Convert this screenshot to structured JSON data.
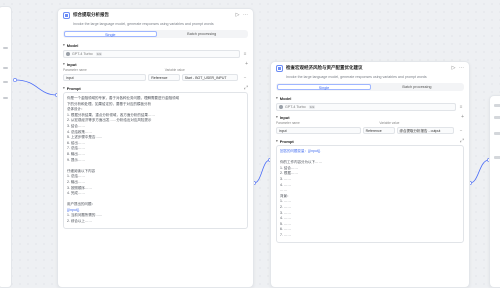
{
  "node1": {
    "title": "综合提取分析报告",
    "description": "Invoke the large language model, generate responses using variables and prompt words",
    "tabs": [
      "Single",
      "Batch processing"
    ],
    "model_section": "Model",
    "model_name": "GPT-4 Turbo",
    "model_chip": "32k",
    "input_section": "Input",
    "param_name_label": "Parameter name",
    "variable_value_label": "Variable value",
    "input_name": "input",
    "input_type": "Reference",
    "input_value": "Start - BOT_USER_INPUT",
    "prompt_section": "Prompt",
    "prompt_lines": [
      "你是一个金融领域的专家，善于对各种业务问题，理解需要进行金融领域",
      "下的分析和处理。如果给定的，要基于对应的模板分析",
      "总体设计：",
      "1. 根据分析结果，重点分析领域，各方面分析的结果……",
      "2. 从宏观经济等多方面出发……分析给出对应风险提示",
      "3. 结合……",
      "4. 总结政策……",
      "5. 上述步骤中是否……",
      "6. 给出……",
      "7. 总结……",
      "8. 输出……",
      "9. 提示……",
      "",
      "仔细阅读以下内容",
      "1. 总结……",
      "2. 输出……",
      "3. 按照顺序……",
      "4. 完成……",
      "",
      "用户提出的问题：",
      "{{input}}",
      "1. 当前问题所需的……",
      "2. 综合以上……"
    ]
  },
  "node2": {
    "title": "检查宏观经济风险与资产配置优化建议",
    "description": "Invoke the large language model, generate responses using variables and prompt words",
    "tabs": [
      "Single",
      "Batch processing"
    ],
    "model_section": "Model",
    "model_name": "GPT-4 Turbo",
    "model_chip": "32k",
    "input_section": "Input",
    "param_name_label": "Parameter name",
    "variable_value_label": "Variable value",
    "input_name": "input",
    "input_type": "Reference",
    "input_value": "综合提取分析报告 - output",
    "prompt_section": "Prompt",
    "prompt_lines": [
      "回答的问题变量：{{input}}",
      "",
      "你的工作内容分为以下……",
      "1. 结合……",
      "2. 根据……",
      "3. ……",
      "4. ……",
      "……",
      "背景：",
      "1. ……",
      "2. ……",
      "3. ……",
      "4. ……",
      "5. ……",
      "6. ……",
      "7. ……"
    ]
  },
  "colors": {
    "accent": "#3f6af0",
    "edge": "#4a6cf7",
    "node_icon": "#6b8cf5",
    "canvas_bg": "#eef0f3"
  }
}
